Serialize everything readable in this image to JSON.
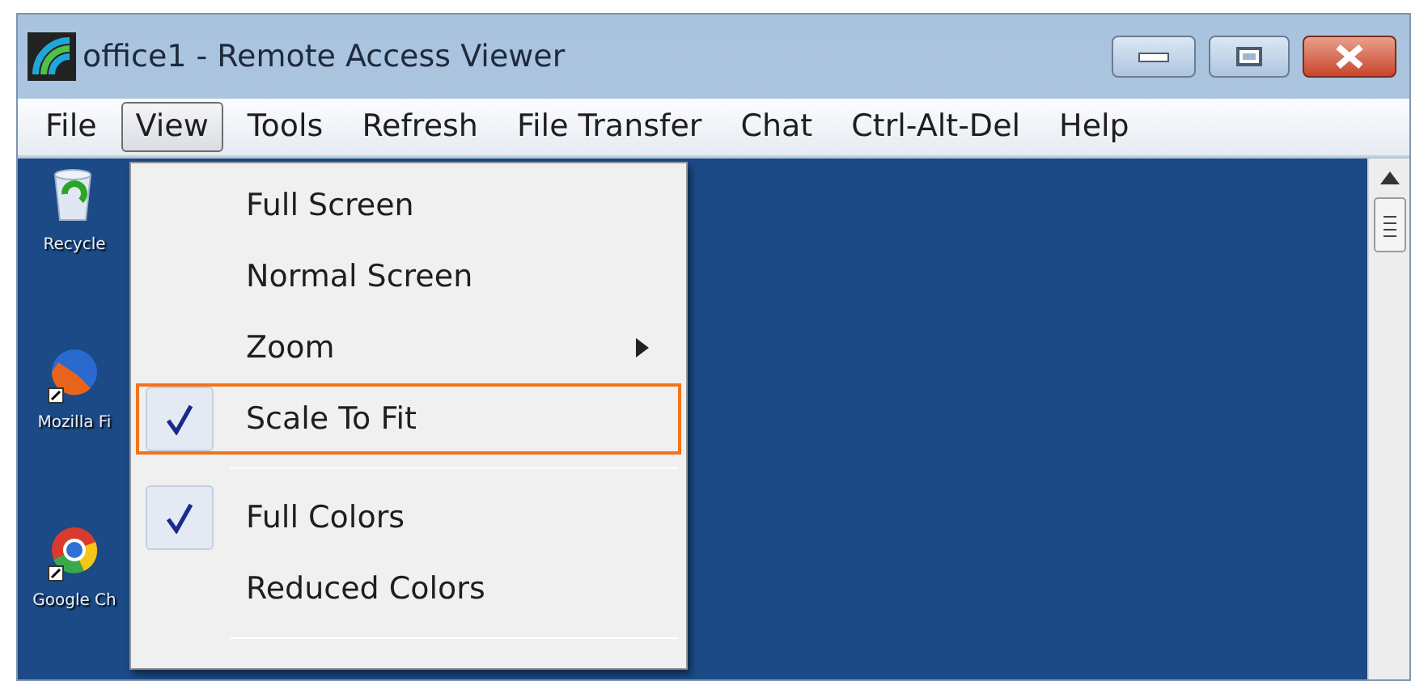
{
  "window": {
    "title": "office1 - Remote Access Viewer"
  },
  "menu_bar": [
    {
      "label": "File",
      "selected": false
    },
    {
      "label": "View",
      "selected": true
    },
    {
      "label": "Tools",
      "selected": false
    },
    {
      "label": "Refresh",
      "selected": false
    },
    {
      "label": "File Transfer",
      "selected": false
    },
    {
      "label": "Chat",
      "selected": false
    },
    {
      "label": "Ctrl-Alt-Del",
      "selected": false
    },
    {
      "label": "Help",
      "selected": false
    }
  ],
  "desktop_icons": [
    {
      "kind": "recycle",
      "label": "Recycle"
    },
    {
      "kind": "globe",
      "label": "Mozilla Fi"
    },
    {
      "kind": "chrome",
      "label": "Google Ch"
    }
  ],
  "view_menu": [
    {
      "kind": "item",
      "label": "Full Screen",
      "checked": false,
      "submenu": false,
      "outlined": false
    },
    {
      "kind": "item",
      "label": "Normal Screen",
      "checked": false,
      "submenu": false,
      "outlined": false
    },
    {
      "kind": "item",
      "label": "Zoom",
      "checked": false,
      "submenu": true,
      "outlined": false
    },
    {
      "kind": "item",
      "label": "Scale To Fit",
      "checked": true,
      "submenu": false,
      "outlined": true
    },
    {
      "kind": "separator"
    },
    {
      "kind": "item",
      "label": "Full Colors",
      "checked": true,
      "submenu": false,
      "outlined": false
    },
    {
      "kind": "item",
      "label": "Reduced Colors",
      "checked": false,
      "submenu": false,
      "outlined": false
    },
    {
      "kind": "separator"
    }
  ]
}
